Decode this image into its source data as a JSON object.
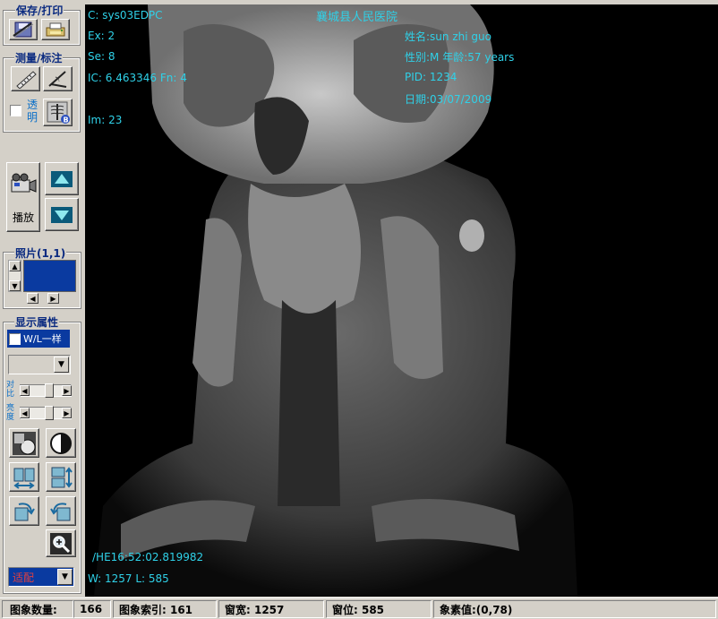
{
  "sidebar": {
    "save_print_title": "保存/打印",
    "measure_title": "测量/标注",
    "transparent_label": "透明",
    "play_label": "播放",
    "photo_title": "照片(1,1)",
    "display_title": "显示属性",
    "wl_same_label": "W/L一样",
    "contrast_label": "对比",
    "brightness_label": "亮度",
    "fit_select_value": "适配",
    "accent_color": "#0a3aa0",
    "fit_text_color": "#c01818"
  },
  "overlay": {
    "l1": "C: sys03EDPC",
    "l2": "Ex: 2",
    "l3": "Se: 8",
    "l4": "IC: 6.463346  Fn: 4",
    "l5": "Im: 23",
    "hospital": "襄城县人民医院",
    "name": "姓名:sun zhi guo",
    "sex_age": "性别:M 年龄:57 years",
    "pid": "PID: 1234",
    "date": "日期:03/07/2009",
    "he": "/HE16:52:02.819982",
    "wl": "W: 1257 L: 585",
    "text_color": "#2fd1e8"
  },
  "status": {
    "image_count_label": "图象数量:",
    "image_count": "166",
    "image_index": "图象索引: 161",
    "window_width": "窗宽: 1257",
    "window_level": "窗位: 585",
    "pixel_value": "象素值:(0,78)"
  }
}
